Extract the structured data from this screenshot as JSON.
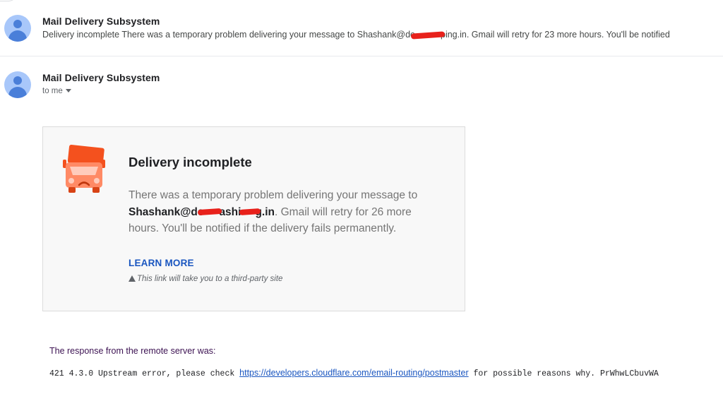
{
  "thread": [
    {
      "sender": "Mail Delivery Subsystem",
      "snippet_before": "Delivery incomplete There was a temporary problem delivering your message to Shashank@de",
      "snippet_after": "ping.in. Gmail will retry for 23 more hours. You'll be notified",
      "avatar_icon": "person-avatar-icon"
    },
    {
      "sender": "Mail Delivery Subsystem",
      "recipient_label": "to me",
      "avatar_icon": "person-avatar-icon"
    }
  ],
  "card": {
    "icon": "sad-truck-icon",
    "title": "Delivery incomplete",
    "text_before": "There was a temporary problem delivering your message to ",
    "email_part1": "Shashank@de",
    "email_part2": "ashi",
    "email_part3": "g.in",
    "text_after": ". Gmail will retry for 26 more hours. You'll be notified if the delivery fails permanently.",
    "learn_more": "LEARN MORE",
    "third_party_note": "This link will take you to a third-party site"
  },
  "response": {
    "label": "The response from the remote server was:",
    "prefix": "421 4.3.0 Upstream error, please check ",
    "link": "https://developers.cloudflare.com/email-routing/postmaster",
    "suffix": " for possible reasons why. PrWhwLCbuvWA"
  },
  "colors": {
    "link": "#1a56c0",
    "redaction": "#e8211b",
    "truck": "#f4511e",
    "avatar_bg": "#a8c7fa",
    "avatar_fg": "#4a7fd9"
  }
}
